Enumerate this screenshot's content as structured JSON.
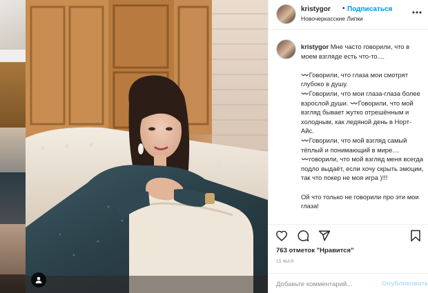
{
  "post": {
    "username": "kristygor",
    "follow_separator": "•",
    "follow_label": "Подписаться",
    "location": "Новочеркасские Липки",
    "caption_username": "kristygor",
    "caption_text": "Мне часто говорили, что в моем взгляде есть что-то....\n\n〰️Говорили, что глаза мои смотрят глубоко в душу.\n〰️Говорили, что мои глаза-глаза более взрослой души. 〰️Говорили, что мой взгляд бывает жутко отрешённым и холодным, как ледяной день в Норт-Айс.\n〰️Говорили, что мой взгляд самый тёплый и понимающий в мире....\n〰️говорили, что мой взгляд меня всегда подло выдаёт, если хочу скрыть эмоции, так что покер не моя игра )!!!\n\nОй что только не говорили про эти мои глаза!",
    "likes_text": "763 отметок \"Нравится\"",
    "date": "15 МАЯ",
    "comment_placeholder": "Добавьте комментарий...",
    "publish_label": "Опубликовать"
  },
  "icons": {
    "more": "more-options-icon",
    "like": "heart-icon",
    "comment": "comment-icon",
    "share": "share-icon",
    "save": "bookmark-icon",
    "tag": "user-tag-icon"
  },
  "colors": {
    "link_blue": "#0095f6",
    "publish_disabled": "#b2dffc",
    "muted_text": "#8e8e8e",
    "border": "#efefef"
  }
}
